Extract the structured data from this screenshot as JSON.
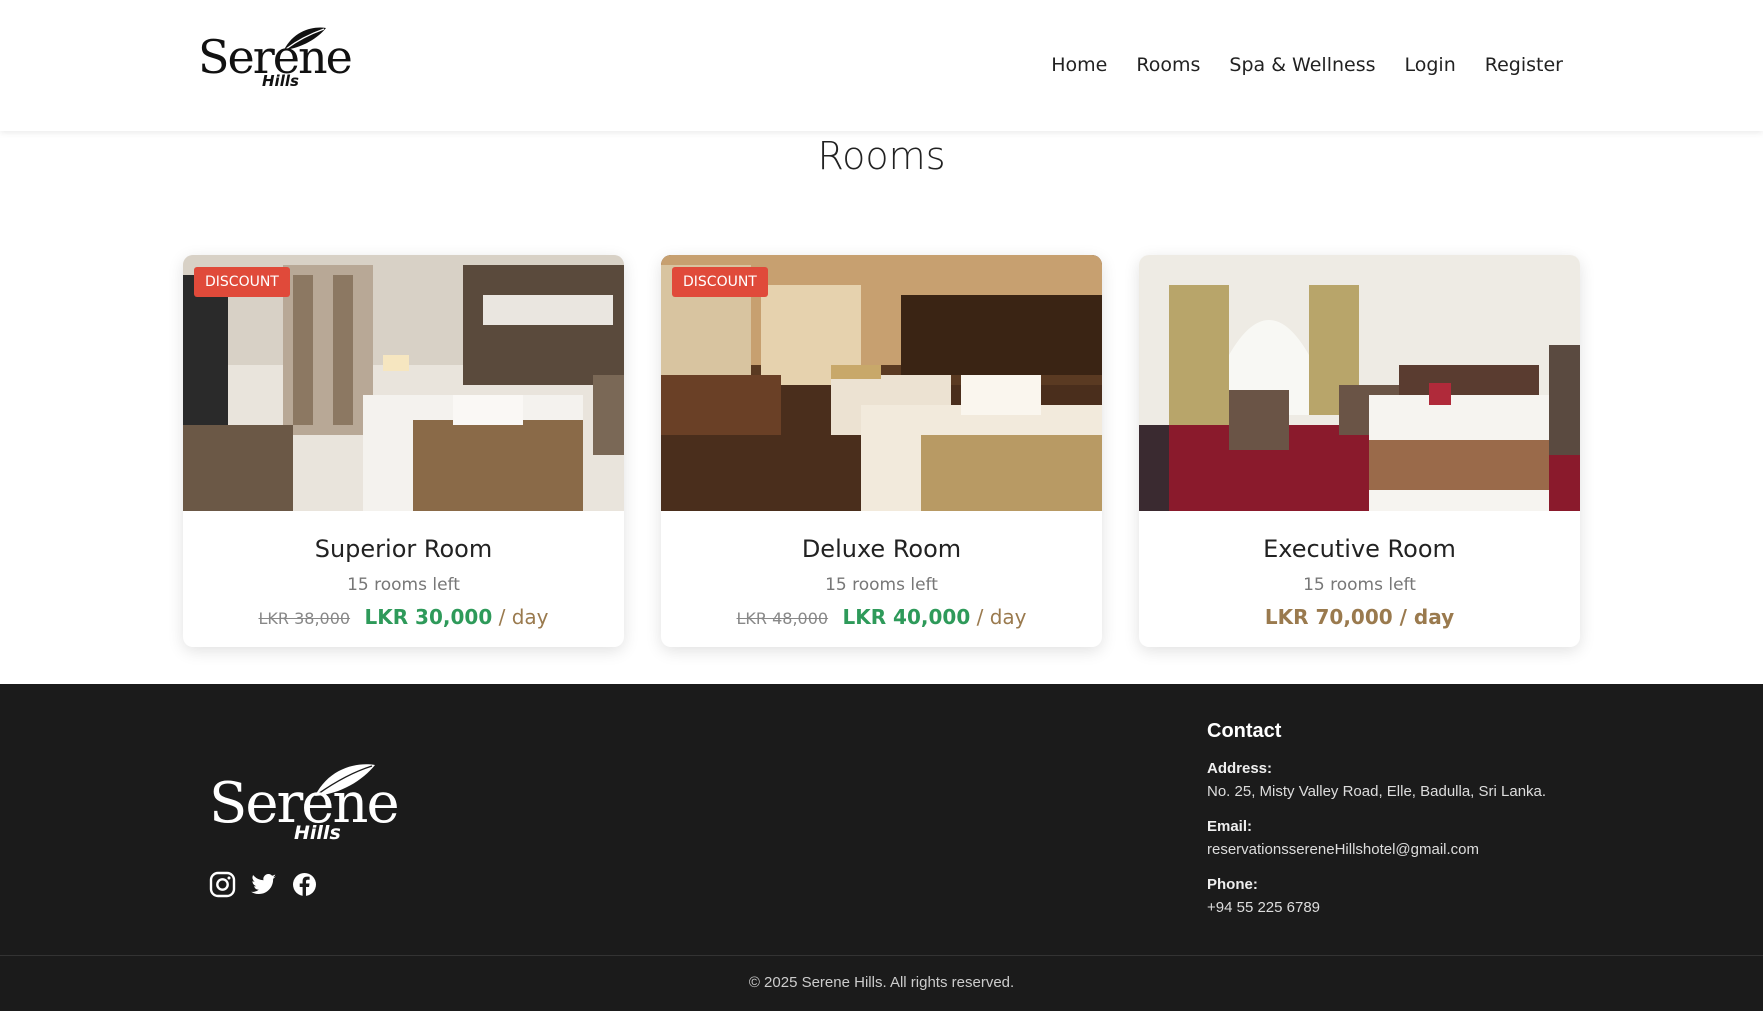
{
  "header": {
    "logo_main": "Serene",
    "logo_sub": "Hills",
    "nav": [
      "Home",
      "Rooms",
      "Spa & Wellness",
      "Login",
      "Register"
    ]
  },
  "page": {
    "title": "Rooms"
  },
  "rooms": [
    {
      "badge": "DISCOUNT",
      "name": "Superior Room",
      "left": "15 rooms left",
      "old_price": "LKR 38,000",
      "price": "LKR 30,000",
      "unit": "/ day"
    },
    {
      "badge": "DISCOUNT",
      "name": "Deluxe Room",
      "left": "15 rooms left",
      "old_price": "LKR 48,000",
      "price": "LKR 40,000",
      "unit": "/ day"
    },
    {
      "name": "Executive Room",
      "left": "15 rooms left",
      "price_full": "LKR 70,000 / day"
    }
  ],
  "footer": {
    "logo_main": "Serene",
    "logo_sub": "Hills",
    "social": [
      "instagram-icon",
      "twitter-icon",
      "facebook-icon"
    ],
    "contact_title": "Contact",
    "address_label": "Address:",
    "address": "No. 25, Misty Valley Road, Elle, Badulla, Sri Lanka.",
    "email_label": "Email:",
    "email": "reservationssereneHillshotel@gmail.com",
    "phone_label": "Phone:",
    "phone": "+94 55 225 6789",
    "copyright": "© 2025 Serene Hills. All rights reserved."
  },
  "colors": {
    "discount": "#e04a3a",
    "price_green": "#2e9a5a",
    "price_brown": "#9a7a4e",
    "footer_bg": "#1b1b1b"
  }
}
